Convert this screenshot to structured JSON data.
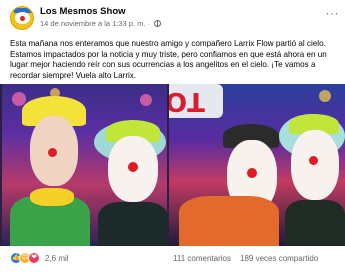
{
  "post": {
    "page_name": "Los Mesmos Show",
    "date": "14 de noviembre a la 1:33 p. m.",
    "meta_separator": "·",
    "more_label": "···",
    "text": "Esta mañana nos enteramos que nuestro amigo y compañero Larrix Flow partió al cielo. Estamos impactados por la noticia y muy triste, pero confiamos en que está ahora en un lugar mejor haciendo reír con sus ocurrencias a los angelitos en el cielo. ¡Te vamos a recordar siempre! Vuela alto Larrix.",
    "sign_text": "TONO"
  },
  "footer": {
    "reaction_count": "2,6 mil",
    "comments": "111 comentarios",
    "shares": "189 veces compartido"
  },
  "icons": {
    "avatar": "clown-logo-icon",
    "privacy": "globe-icon",
    "reactions": [
      "like-icon",
      "sad-icon",
      "love-icon"
    ]
  },
  "colors": {
    "link_gray": "#65676b",
    "like_blue": "#1877f2",
    "sad_yellow": "#f7b125",
    "love_red": "#f33e58"
  }
}
